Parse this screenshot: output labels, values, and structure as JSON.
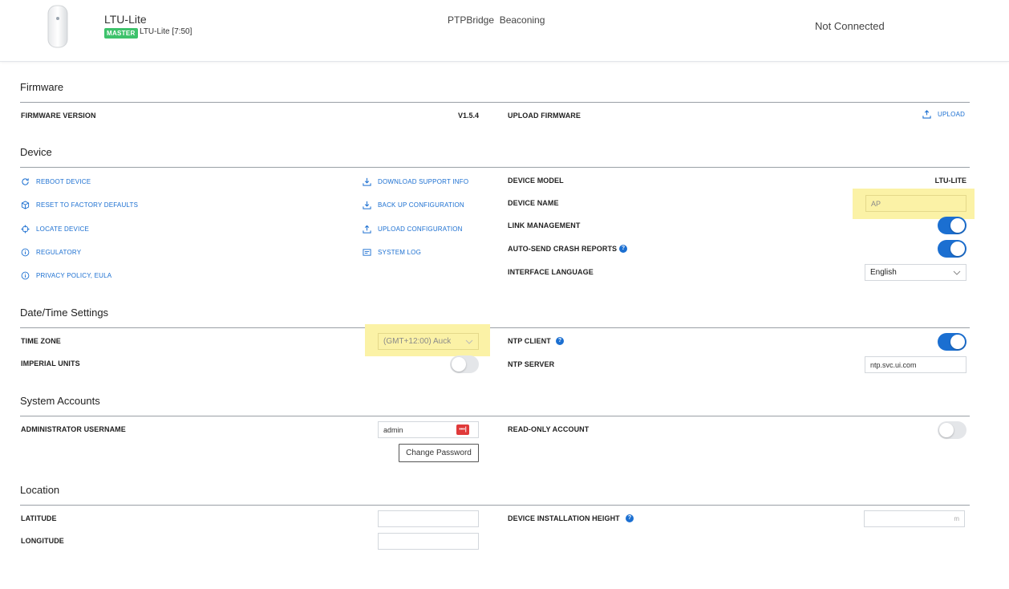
{
  "header": {
    "device_title": "LTU-Lite",
    "badge": "MASTER",
    "device_subtitle": "LTU-Lite [7:50]",
    "mode": "PTPBridge  Beaconing",
    "status": "Not Connected"
  },
  "firmware": {
    "title": "Firmware",
    "version_label": "FIRMWARE VERSION",
    "version_value": "V1.5.4",
    "upload_label": "UPLOAD FIRMWARE",
    "upload_link": "UPLOAD"
  },
  "device": {
    "title": "Device",
    "actions_left": [
      "REBOOT DEVICE",
      "RESET TO FACTORY DEFAULTS",
      "LOCATE DEVICE",
      "REGULATORY",
      "PRIVACY POLICY, EULA"
    ],
    "actions_right": [
      "DOWNLOAD SUPPORT INFO",
      "BACK UP CONFIGURATION",
      "UPLOAD CONFIGURATION",
      "SYSTEM LOG"
    ],
    "model_label": "DEVICE MODEL",
    "model_value": "LTU-LITE",
    "name_label": "DEVICE NAME",
    "name_value": "AP",
    "link_mgmt_label": "LINK MANAGEMENT",
    "crash_label": "AUTO-SEND CRASH REPORTS",
    "lang_label": "INTERFACE LANGUAGE",
    "lang_value": "English"
  },
  "datetime": {
    "title": "Date/Time Settings",
    "tz_label": "TIME ZONE",
    "tz_value": "(GMT+12:00) Auck",
    "imperial_label": "IMPERIAL UNITS",
    "ntp_client_label": "NTP CLIENT",
    "ntp_server_label": "NTP SERVER",
    "ntp_server_value": "ntp.svc.ui.com"
  },
  "accounts": {
    "title": "System Accounts",
    "admin_label": "ADMINISTRATOR USERNAME",
    "admin_value": "admin",
    "change_pw": "Change Password",
    "readonly_label": "READ-ONLY ACCOUNT"
  },
  "location": {
    "title": "Location",
    "lat_label": "LATITUDE",
    "lon_label": "LONGITUDE",
    "height_label": "DEVICE INSTALLATION HEIGHT",
    "height_unit": "m"
  },
  "toggles": {
    "link_management": true,
    "auto_send_crash": true,
    "imperial_units": false,
    "ntp_client": true,
    "read_only_account": false
  },
  "colors": {
    "accent": "#1b6fd1",
    "badge": "#3dc26b",
    "highlight": "#fbf2a6",
    "password_icon": "#e03a3a"
  }
}
